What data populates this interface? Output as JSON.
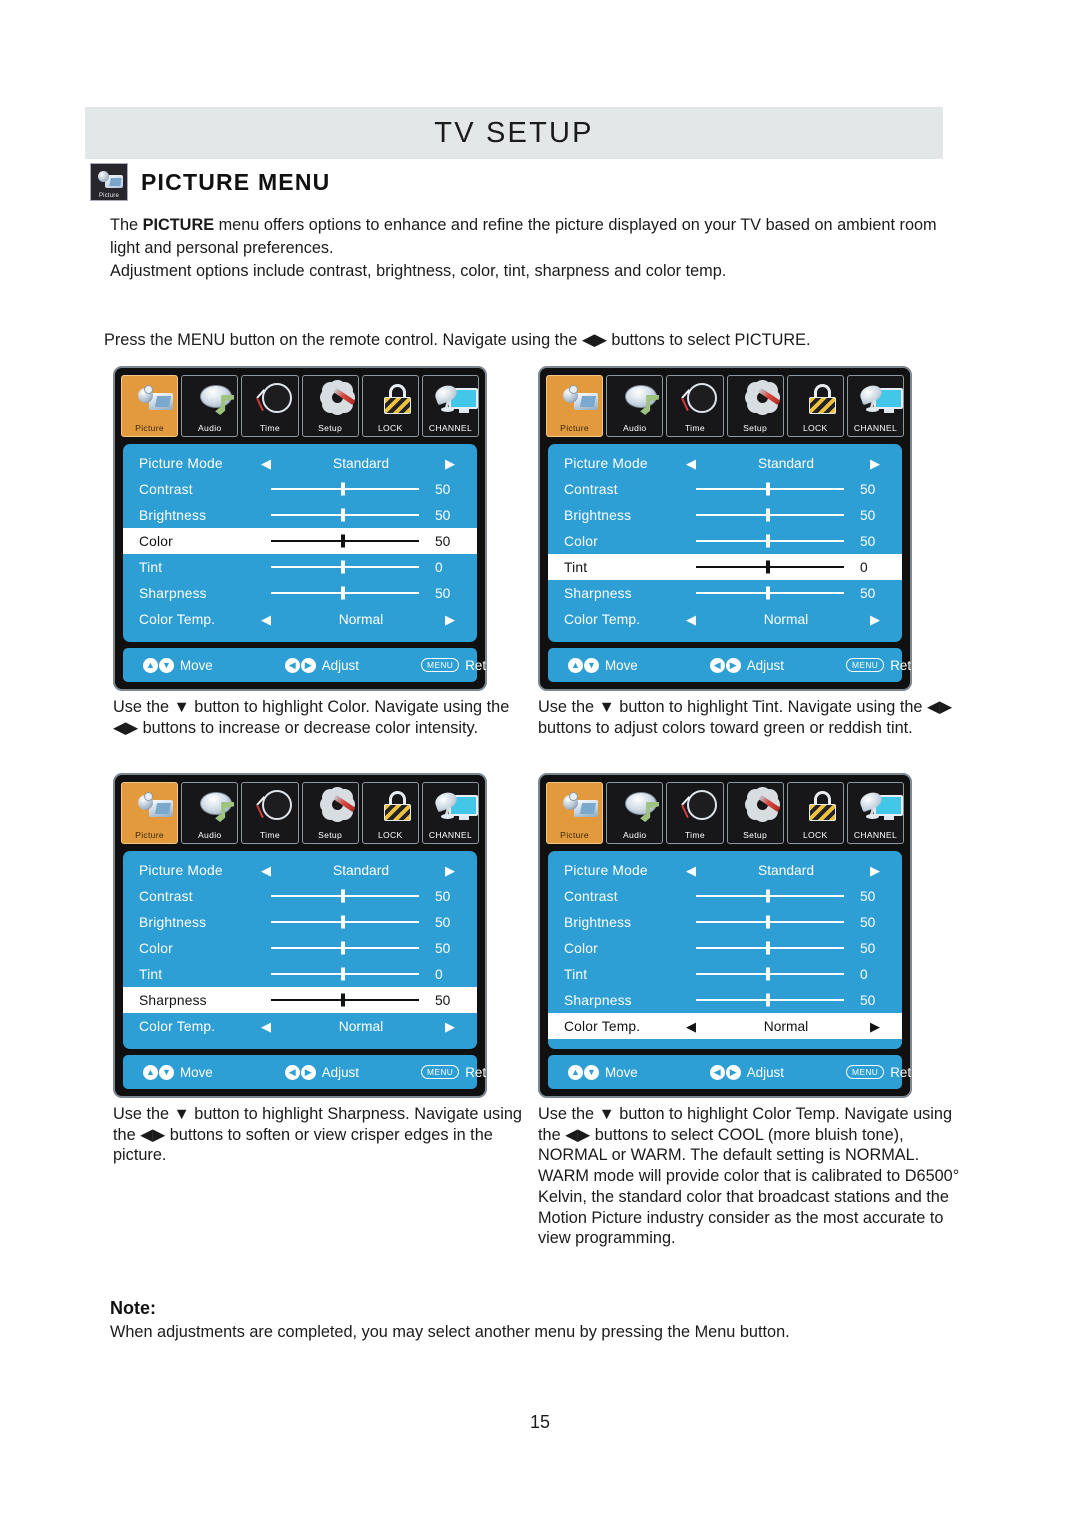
{
  "header": {
    "title": "TV SETUP"
  },
  "section": {
    "icon_label": "Picture",
    "title": "PICTURE MENU"
  },
  "intro": {
    "line1_pre": "The ",
    "line1_bold": "PICTURE",
    "line1_post": " menu offers options to enhance and refine the picture displayed on your TV based on ambient room light and personal preferences.",
    "line2": "Adjustment options include contrast, brightness, color, tint, sharpness and color temp."
  },
  "lead_line": "Press the MENU button on the remote control. Navigate using the ◀▶ buttons to select PICTURE.",
  "tabs": [
    {
      "label": "Picture",
      "icon": "camera-icon",
      "active": true
    },
    {
      "label": "Audio",
      "icon": "audio-disc-note-icon",
      "active": false
    },
    {
      "label": "Time",
      "icon": "clock-icon",
      "active": false
    },
    {
      "label": "Setup",
      "icon": "gear-screwdriver-icon",
      "active": false
    },
    {
      "label": "LOCK",
      "icon": "padlock-icon",
      "active": false
    },
    {
      "label": "CHANNEL",
      "icon": "satellite-tv-icon",
      "active": false
    }
  ],
  "menu_rows": [
    {
      "label": "Picture Mode",
      "type": "option",
      "value": "Standard"
    },
    {
      "label": "Contrast",
      "type": "slider",
      "value": "50",
      "pos": 50
    },
    {
      "label": "Brightness",
      "type": "slider",
      "value": "50",
      "pos": 50
    },
    {
      "label": "Color",
      "type": "slider",
      "value": "50",
      "pos": 50
    },
    {
      "label": "Tint",
      "type": "slider",
      "value": "0",
      "pos": 50
    },
    {
      "label": "Sharpness",
      "type": "slider",
      "value": "50",
      "pos": 50
    },
    {
      "label": "Color Temp.",
      "type": "option",
      "value": "Normal"
    }
  ],
  "footer": {
    "move_label": "Move",
    "adjust_label": "Adjust",
    "return_label": "Return",
    "menu_key": "MENU",
    "up_glyph": "▲",
    "down_glyph": "▼",
    "left_glyph": "◀",
    "right_glyph": "▶"
  },
  "panels": [
    {
      "id": "panel-color",
      "selected_row": 3
    },
    {
      "id": "panel-tint",
      "selected_row": 4
    },
    {
      "id": "panel-sharpness",
      "selected_row": 5
    },
    {
      "id": "panel-colortemp",
      "selected_row": 6
    }
  ],
  "captions": {
    "c1": "Use the ▼ button to highlight Color. Navigate using the ◀▶ buttons to increase or decrease color intensity.",
    "c2": "Use the ▼ button to highlight Tint. Navigate using the ◀▶ buttons to adjust colors toward green or reddish tint.",
    "c3": "Use the ▼ button to highlight Sharpness. Navigate using the ◀▶ buttons to soften or view crisper edges in the picture.",
    "c4": "Use the ▼ button to highlight Color Temp. Navigate using the ◀▶ buttons to select COOL (more bluish tone), NORMAL or WARM. The default setting is NORMAL. WARM mode will provide color that is calibrated to D6500° Kelvin, the standard color that broadcast stations and the Motion Picture industry consider as the most accurate to view programming."
  },
  "note": {
    "title": "Note:",
    "body": "When adjustments are completed, you may select another menu by pressing the Menu button."
  },
  "page_number": "15",
  "colors": {
    "menu_blue": "#2e9fd4",
    "tab_active": "#e29a3d",
    "header_band": "#e3e7e7",
    "osd_frame": "#101010"
  }
}
